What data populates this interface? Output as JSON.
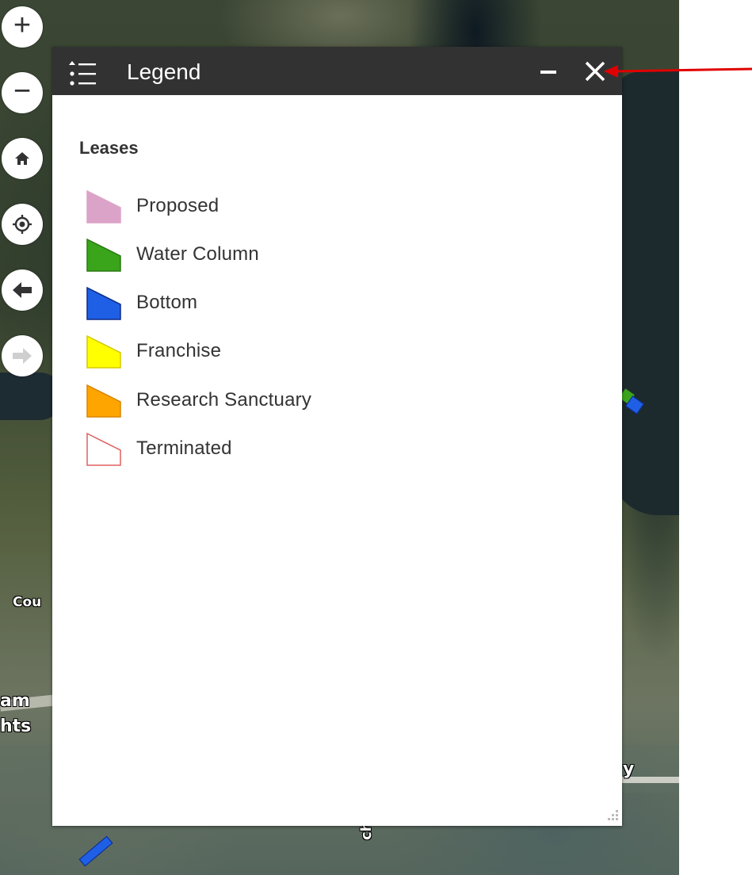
{
  "map": {
    "labels": {
      "place_left_1": "Cou",
      "place_left_2": "am",
      "place_left_3": "hts",
      "road_bottom": "ch-Cs",
      "place_right": "y"
    }
  },
  "controls": {
    "zoom_in": "+",
    "zoom_out": "−"
  },
  "legend": {
    "title": "Legend",
    "section": "Leases",
    "items": [
      {
        "label": "Proposed",
        "fill": "#dca3c8",
        "stroke": "#dca3c8"
      },
      {
        "label": "Water Column",
        "fill": "#3aa51b",
        "stroke": "#2a7a12"
      },
      {
        "label": "Bottom",
        "fill": "#1f5fe6",
        "stroke": "#0b2a86"
      },
      {
        "label": "Franchise",
        "fill": "#ffff00",
        "stroke": "#d6c800"
      },
      {
        "label": "Research Sanctuary",
        "fill": "#ffa500",
        "stroke": "#d98500"
      },
      {
        "label": "Terminated",
        "fill": "#ffffff",
        "stroke": "#e06060"
      }
    ]
  },
  "colors": {
    "header_bg": "#323232",
    "annotation_arrow": "#e00000"
  }
}
